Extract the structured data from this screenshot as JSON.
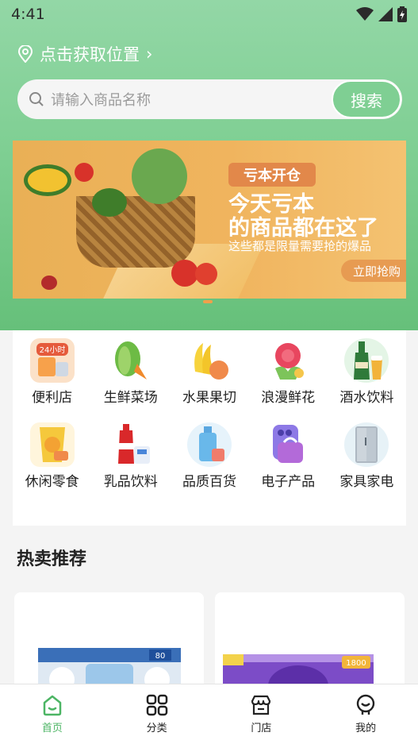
{
  "status_bar": {
    "time": "4:41"
  },
  "location": {
    "label": "点击获取位置",
    "chevron": "›"
  },
  "search": {
    "placeholder": "请输入商品名称",
    "button_label": "搜索"
  },
  "banner": {
    "tag": "亏本开仓",
    "title_line1": "今天亏本",
    "title_line2": "的商品都在这了",
    "subtitle": "这些都是限量需要抢的爆品",
    "button_label": "立即抢购"
  },
  "categories": [
    {
      "label": "便利店",
      "icon": "convenience-store-icon",
      "badge": "24小时"
    },
    {
      "label": "生鲜菜场",
      "icon": "vegetables-icon"
    },
    {
      "label": "水果果切",
      "icon": "fruit-icon"
    },
    {
      "label": "浪漫鲜花",
      "icon": "flower-icon"
    },
    {
      "label": "酒水饮料",
      "icon": "beer-icon"
    },
    {
      "label": "休闲零食",
      "icon": "snacks-icon"
    },
    {
      "label": "乳品饮料",
      "icon": "drinks-icon"
    },
    {
      "label": "品质百货",
      "icon": "goods-icon"
    },
    {
      "label": "电子产品",
      "icon": "phone-icon"
    },
    {
      "label": "家具家电",
      "icon": "fridge-icon"
    }
  ],
  "hot": {
    "title": "热卖推荐"
  },
  "products": [
    {
      "badge": "80"
    },
    {
      "badge": "1800"
    }
  ],
  "tabbar": [
    {
      "label": "首页",
      "icon": "home-icon",
      "active": true
    },
    {
      "label": "分类",
      "icon": "grid-icon",
      "active": false
    },
    {
      "label": "门店",
      "icon": "store-icon",
      "active": false
    },
    {
      "label": "我的",
      "icon": "profile-icon",
      "active": false
    }
  ],
  "colors": {
    "accent": "#7fcf93",
    "active_tab": "#4cb564"
  }
}
